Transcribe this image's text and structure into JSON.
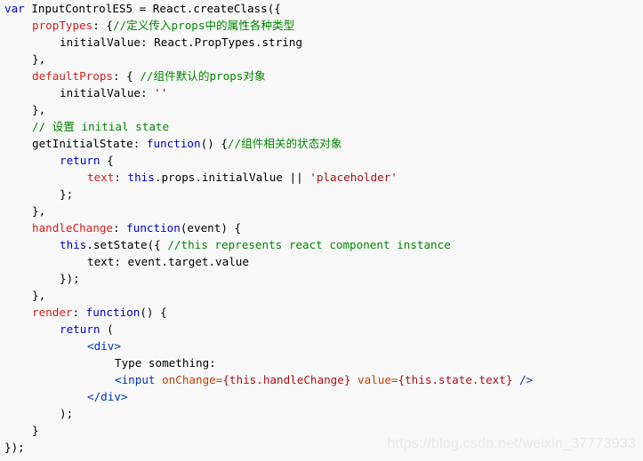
{
  "colors": {
    "background": "#f8f8f8",
    "plain": "#000000",
    "keyword": "#0000cc",
    "property": "#d02020",
    "comment": "#008800",
    "string": "#aa1111",
    "tag": "#0033bb",
    "attribute": "#c04000"
  },
  "code": {
    "language": "javascript-jsx",
    "lines": [
      {
        "indent": 0,
        "tokens": [
          {
            "t": "var",
            "c": "keyword"
          },
          {
            "t": " InputControlES5 = React.createClass({",
            "c": "plain"
          }
        ]
      },
      {
        "indent": 1,
        "tokens": [
          {
            "t": "propTypes",
            "c": "property"
          },
          {
            "t": ": {",
            "c": "plain"
          },
          {
            "t": "//定义传入props中的属性各种类型",
            "c": "comment"
          }
        ]
      },
      {
        "indent": 2,
        "tokens": [
          {
            "t": "initialValue: React.PropTypes.string",
            "c": "plain"
          }
        ]
      },
      {
        "indent": 1,
        "tokens": [
          {
            "t": "},",
            "c": "plain"
          }
        ]
      },
      {
        "indent": 1,
        "tokens": [
          {
            "t": "defaultProps",
            "c": "property"
          },
          {
            "t": ": { ",
            "c": "plain"
          },
          {
            "t": "//组件默认的props对象",
            "c": "comment"
          }
        ]
      },
      {
        "indent": 2,
        "tokens": [
          {
            "t": "initialValue: ",
            "c": "plain"
          },
          {
            "t": "''",
            "c": "string"
          }
        ]
      },
      {
        "indent": 1,
        "tokens": [
          {
            "t": "},",
            "c": "plain"
          }
        ]
      },
      {
        "indent": 1,
        "tokens": [
          {
            "t": "// 设置 initial state",
            "c": "comment"
          }
        ]
      },
      {
        "indent": 1,
        "tokens": [
          {
            "t": "getInitialState: ",
            "c": "plain"
          },
          {
            "t": "function",
            "c": "keyword"
          },
          {
            "t": "() {",
            "c": "plain"
          },
          {
            "t": "//组件相关的状态对象",
            "c": "comment"
          }
        ]
      },
      {
        "indent": 2,
        "tokens": [
          {
            "t": "return",
            "c": "keyword"
          },
          {
            "t": " {",
            "c": "plain"
          }
        ]
      },
      {
        "indent": 3,
        "tokens": [
          {
            "t": "text",
            "c": "property"
          },
          {
            "t": ": ",
            "c": "plain"
          },
          {
            "t": "this",
            "c": "keyword"
          },
          {
            "t": ".props.initialValue || ",
            "c": "plain"
          },
          {
            "t": "'placeholder'",
            "c": "string"
          }
        ]
      },
      {
        "indent": 2,
        "tokens": [
          {
            "t": "};",
            "c": "plain"
          }
        ]
      },
      {
        "indent": 1,
        "tokens": [
          {
            "t": "},",
            "c": "plain"
          }
        ]
      },
      {
        "indent": 1,
        "tokens": [
          {
            "t": "handleChange",
            "c": "property"
          },
          {
            "t": ": ",
            "c": "plain"
          },
          {
            "t": "function",
            "c": "keyword"
          },
          {
            "t": "(event) {",
            "c": "plain"
          }
        ]
      },
      {
        "indent": 2,
        "tokens": [
          {
            "t": "this",
            "c": "keyword"
          },
          {
            "t": ".setState({ ",
            "c": "plain"
          },
          {
            "t": "//this represents react component instance",
            "c": "comment"
          }
        ]
      },
      {
        "indent": 3,
        "tokens": [
          {
            "t": "text: event.target.value",
            "c": "plain"
          }
        ]
      },
      {
        "indent": 2,
        "tokens": [
          {
            "t": "});",
            "c": "plain"
          }
        ]
      },
      {
        "indent": 1,
        "tokens": [
          {
            "t": "},",
            "c": "plain"
          }
        ]
      },
      {
        "indent": 1,
        "tokens": [
          {
            "t": "render",
            "c": "property"
          },
          {
            "t": ": ",
            "c": "plain"
          },
          {
            "t": "function",
            "c": "keyword"
          },
          {
            "t": "() {",
            "c": "plain"
          }
        ]
      },
      {
        "indent": 2,
        "tokens": [
          {
            "t": "return",
            "c": "keyword"
          },
          {
            "t": " (",
            "c": "plain"
          }
        ]
      },
      {
        "indent": 3,
        "tokens": [
          {
            "t": "<div>",
            "c": "tag"
          }
        ]
      },
      {
        "indent": 4,
        "tokens": [
          {
            "t": "Type something:",
            "c": "plain"
          }
        ]
      },
      {
        "indent": 4,
        "tokens": [
          {
            "t": "<input",
            "c": "tag"
          },
          {
            "t": " ",
            "c": "plain"
          },
          {
            "t": "onChange=",
            "c": "attribute"
          },
          {
            "t": "{this.handleChange}",
            "c": "string"
          },
          {
            "t": " ",
            "c": "plain"
          },
          {
            "t": "value=",
            "c": "attribute"
          },
          {
            "t": "{this.state.text}",
            "c": "string"
          },
          {
            "t": " />",
            "c": "tag"
          }
        ]
      },
      {
        "indent": 3,
        "tokens": [
          {
            "t": "</div>",
            "c": "tag"
          }
        ]
      },
      {
        "indent": 2,
        "tokens": [
          {
            "t": ");",
            "c": "plain"
          }
        ]
      },
      {
        "indent": 1,
        "tokens": [
          {
            "t": "}",
            "c": "plain"
          }
        ]
      },
      {
        "indent": 0,
        "tokens": [
          {
            "t": "});",
            "c": "plain"
          }
        ]
      }
    ]
  },
  "watermark": "https://blog.csdn.net/weixin_37773933"
}
